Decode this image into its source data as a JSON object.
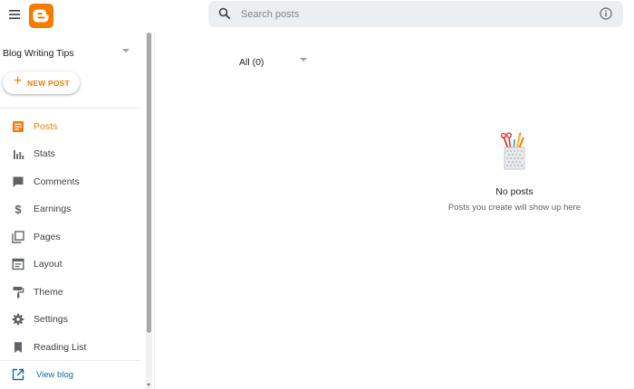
{
  "search": {
    "placeholder": "Search posts"
  },
  "sidebar": {
    "blog_name": "Blog Writing Tips",
    "new_post_label": "NEW POST",
    "items": [
      {
        "label": "Posts",
        "icon": "posts-icon",
        "active": true
      },
      {
        "label": "Stats",
        "icon": "stats-icon"
      },
      {
        "label": "Comments",
        "icon": "comments-icon"
      },
      {
        "label": "Earnings",
        "icon": "dollar-icon"
      },
      {
        "label": "Pages",
        "icon": "pages-icon"
      },
      {
        "label": "Layout",
        "icon": "layout-icon"
      },
      {
        "label": "Theme",
        "icon": "paint-roller-icon"
      },
      {
        "label": "Settings",
        "icon": "gear-icon"
      },
      {
        "label": "Reading List",
        "icon": "bookmark-icon"
      }
    ],
    "view_blog_label": "View blog"
  },
  "main": {
    "filter_label": "All (0)",
    "empty_title": "No posts",
    "empty_subtitle": "Posts you create will show up here"
  },
  "colors": {
    "accent": "#f57c00",
    "link": "#0b6fa4",
    "icon": "#5f6368"
  }
}
